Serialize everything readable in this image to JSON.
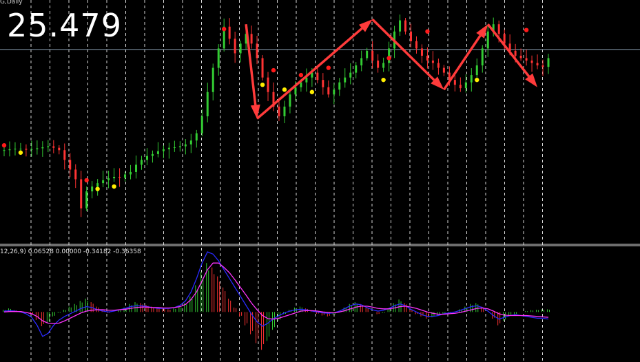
{
  "header": {
    "symbol_tf": "G,Daily",
    "price": "25.479"
  },
  "indicator": {
    "macd_label": "12,26,9) 0.06528 0.00000 -0.34182 -0.36358"
  },
  "colors": {
    "background": "#000000",
    "grid": "#ffffff",
    "bull_candle": "#33cc33",
    "bear_candle": "#ff3333",
    "arrow": "#ff3b3b",
    "dot_high": "#ff1a1a",
    "dot_low": "#ffee00",
    "hline": "#8aa0b4",
    "macd_main": "#2a2aff",
    "macd_signal": "#ff33ff"
  },
  "chart_data": [
    {
      "type": "candlestick",
      "series": [
        {
          "name": "price",
          "values": [
            23.4,
            23.42,
            23.43,
            23.43,
            23.41,
            23.42,
            23.44,
            23.46,
            23.48,
            23.45,
            23.4,
            23.2,
            23.0,
            22.8,
            22.2,
            22.55,
            22.65,
            22.72,
            22.78,
            22.82,
            22.85,
            22.83,
            22.9,
            22.95,
            23.1,
            23.2,
            23.28,
            23.32,
            23.38,
            23.42,
            23.45,
            23.46,
            23.48,
            23.52,
            23.6,
            23.75,
            24.1,
            24.6,
            25.1,
            25.5,
            25.95,
            25.7,
            25.4,
            25.6,
            25.8,
            25.6,
            25.3,
            24.9,
            24.6,
            24.3,
            24.1,
            24.3,
            24.55,
            24.7,
            24.8,
            24.9,
            25.0,
            24.85,
            24.7,
            24.55,
            24.65,
            24.8,
            24.9,
            25.0,
            25.15,
            25.3,
            25.45,
            25.25,
            25.1,
            25.2,
            25.5,
            25.85,
            26.08,
            25.85,
            25.65,
            25.5,
            25.35,
            25.25,
            25.2,
            25.1,
            25.0,
            24.85,
            24.75,
            24.68,
            24.8,
            24.95,
            25.15,
            25.5,
            25.85,
            26.0,
            25.8,
            25.6,
            25.45,
            25.35,
            25.3,
            25.25,
            25.2,
            25.15,
            25.12,
            25.3
          ]
        }
      ],
      "markers": {
        "high": [
          [
            0,
            23.5
          ],
          [
            15,
            22.78
          ],
          [
            40,
            25.9
          ],
          [
            49,
            25.05
          ],
          [
            54,
            24.95
          ],
          [
            59,
            25.1
          ],
          [
            70,
            25.3
          ],
          [
            77,
            25.85
          ],
          [
            95,
            25.88
          ]
        ],
        "low": [
          [
            3,
            23.35
          ],
          [
            17,
            22.6
          ],
          [
            20,
            22.65
          ],
          [
            47,
            24.75
          ],
          [
            51,
            24.65
          ],
          [
            56,
            24.6
          ],
          [
            69,
            24.85
          ],
          [
            86,
            24.85
          ]
        ]
      },
      "zigzag": [
        [
          44,
          26.0
        ],
        [
          46,
          24.05
        ],
        [
          67,
          26.1
        ],
        [
          80,
          24.65
        ],
        [
          88,
          26.0
        ],
        [
          97,
          24.7
        ]
      ],
      "current_price": 25.479
    },
    {
      "type": "macd",
      "histogram": [
        0.05,
        0.08,
        0.04,
        0.02,
        0.0,
        -0.05,
        -0.18,
        -0.32,
        -0.25,
        -0.1,
        -0.02,
        0.05,
        0.12,
        0.18,
        0.25,
        0.3,
        0.22,
        0.12,
        0.05,
        -0.02,
        0.0,
        0.04,
        0.1,
        0.18,
        0.22,
        0.2,
        0.16,
        0.12,
        0.1,
        0.08,
        0.06,
        0.08,
        0.12,
        0.2,
        0.35,
        0.6,
        0.9,
        1.1,
        1.0,
        0.8,
        0.55,
        0.3,
        0.1,
        -0.1,
        -0.3,
        -0.5,
        -0.7,
        -0.85,
        -0.65,
        -0.4,
        -0.2,
        -0.05,
        0.05,
        0.1,
        0.12,
        0.08,
        0.02,
        -0.04,
        -0.08,
        -0.1,
        -0.06,
        0.02,
        0.1,
        0.18,
        0.22,
        0.18,
        0.1,
        0.0,
        -0.05,
        -0.02,
        0.08,
        0.2,
        0.28,
        0.2,
        0.05,
        -0.05,
        -0.1,
        -0.15,
        -0.12,
        -0.08,
        -0.04,
        -0.02,
        0.0,
        0.06,
        0.12,
        0.18,
        0.2,
        0.12,
        0.0,
        -0.15,
        -0.3,
        -0.2,
        -0.1,
        -0.05,
        0.0,
        0.02,
        0.04,
        0.05,
        0.06,
        0.06
      ],
      "main": [
        0.02,
        0.03,
        0.02,
        0.0,
        -0.04,
        -0.12,
        -0.3,
        -0.55,
        -0.48,
        -0.3,
        -0.18,
        -0.1,
        -0.04,
        0.02,
        0.08,
        0.12,
        0.1,
        0.05,
        0.02,
        0.0,
        0.02,
        0.05,
        0.08,
        0.12,
        0.14,
        0.14,
        0.12,
        0.1,
        0.08,
        0.08,
        0.08,
        0.1,
        0.15,
        0.25,
        0.45,
        0.75,
        1.1,
        1.35,
        1.3,
        1.15,
        0.95,
        0.75,
        0.55,
        0.35,
        0.15,
        -0.05,
        -0.22,
        -0.32,
        -0.25,
        -0.15,
        -0.08,
        -0.02,
        0.02,
        0.05,
        0.06,
        0.05,
        0.02,
        0.0,
        -0.02,
        -0.03,
        -0.02,
        0.02,
        0.08,
        0.14,
        0.18,
        0.16,
        0.1,
        0.05,
        0.02,
        0.04,
        0.08,
        0.14,
        0.18,
        0.14,
        0.06,
        0.0,
        -0.06,
        -0.1,
        -0.1,
        -0.08,
        -0.04,
        -0.02,
        0.0,
        0.04,
        0.08,
        0.12,
        0.14,
        0.1,
        0.02,
        -0.08,
        -0.16,
        -0.12,
        -0.08,
        -0.06,
        -0.08,
        -0.1,
        -0.12,
        -0.14,
        -0.14,
        -0.16
      ],
      "signal": [
        0.0,
        0.01,
        0.01,
        0.01,
        -0.01,
        -0.04,
        -0.1,
        -0.2,
        -0.25,
        -0.26,
        -0.25,
        -0.2,
        -0.14,
        -0.08,
        -0.02,
        0.02,
        0.04,
        0.05,
        0.05,
        0.04,
        0.04,
        0.05,
        0.06,
        0.08,
        0.1,
        0.11,
        0.11,
        0.1,
        0.1,
        0.09,
        0.09,
        0.1,
        0.12,
        0.17,
        0.28,
        0.45,
        0.7,
        0.95,
        1.1,
        1.1,
        1.0,
        0.88,
        0.72,
        0.55,
        0.38,
        0.2,
        0.05,
        -0.08,
        -0.15,
        -0.16,
        -0.14,
        -0.1,
        -0.06,
        -0.02,
        0.02,
        0.03,
        0.03,
        0.02,
        0.0,
        -0.01,
        -0.02,
        0.0,
        0.03,
        0.07,
        0.11,
        0.13,
        0.13,
        0.11,
        0.08,
        0.07,
        0.07,
        0.09,
        0.12,
        0.13,
        0.11,
        0.08,
        0.04,
        0.0,
        -0.03,
        -0.05,
        -0.05,
        -0.04,
        -0.03,
        -0.01,
        0.02,
        0.05,
        0.08,
        0.09,
        0.07,
        0.02,
        -0.04,
        -0.07,
        -0.08,
        -0.08,
        -0.08,
        -0.08,
        -0.09,
        -0.1,
        -0.11,
        -0.12
      ]
    }
  ]
}
